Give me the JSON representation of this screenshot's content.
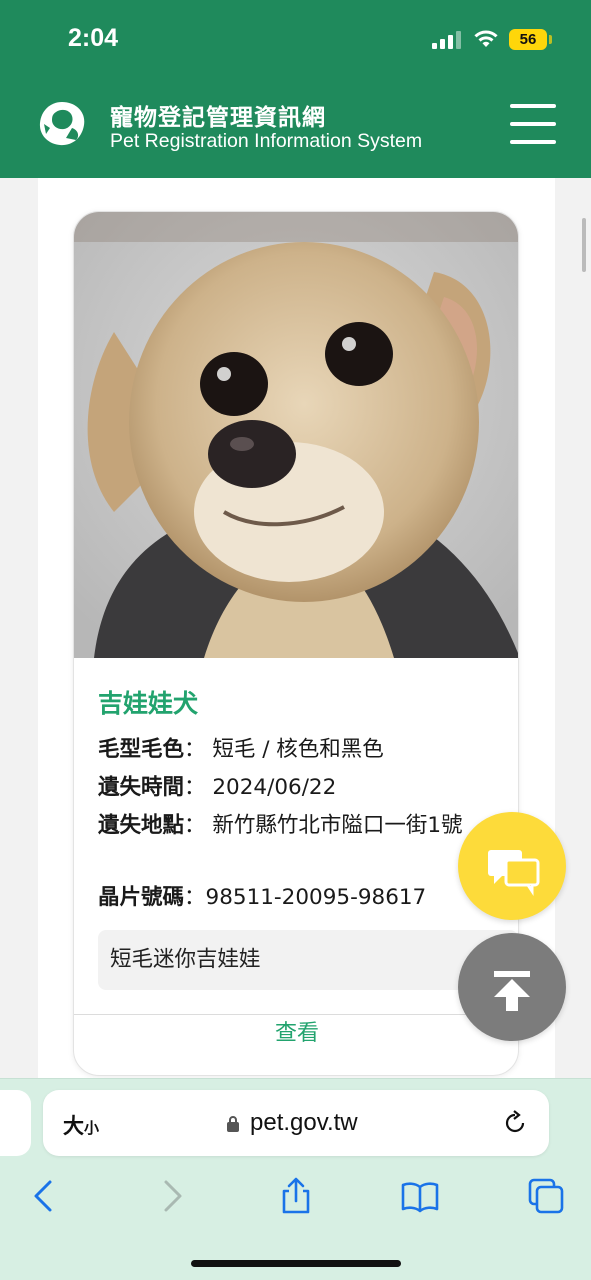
{
  "status_bar": {
    "time": "2:04",
    "battery": "56"
  },
  "header": {
    "title_zh": "寵物登記管理資訊網",
    "title_en": "Pet Registration Information System"
  },
  "card": {
    "breed": "吉娃娃犬",
    "fields": [
      {
        "label": "毛型毛色",
        "sep": "：",
        "value": "短毛 / 核色和黑色"
      },
      {
        "label": "遺失時間",
        "sep": "：",
        "value": "2024/06/22"
      },
      {
        "label": "遺失地點",
        "sep": "：",
        "value": "新竹縣竹北市隘口一街1號"
      },
      {
        "label": "晶片號碼",
        "sep": "：",
        "value": "98511-20095-98617"
      }
    ],
    "description": "短毛迷你吉娃娃",
    "view_button": "查看"
  },
  "browser": {
    "text_size": "大",
    "text_size_small": "小",
    "url": "pet.gov.tw"
  },
  "colors": {
    "brand": "#1f8a5c",
    "accent": "#22a36e",
    "chat_button": "#fddb3a",
    "top_button": "#7c7c7c"
  }
}
